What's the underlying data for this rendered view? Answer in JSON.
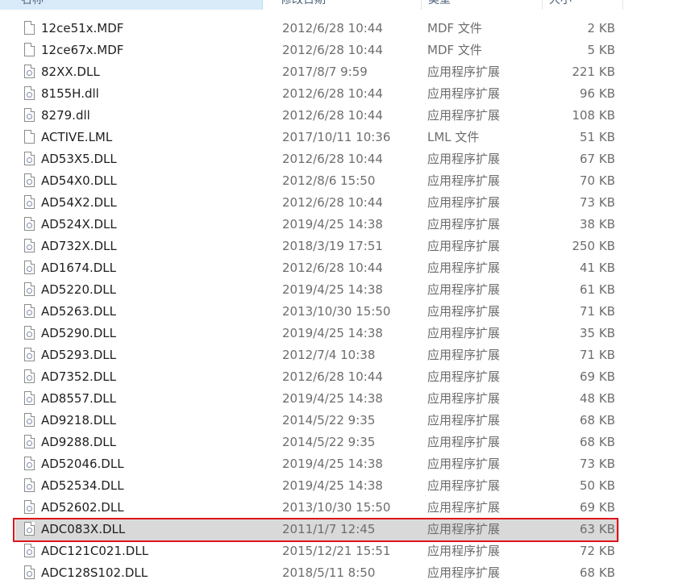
{
  "columns": {
    "name": "名称",
    "date": "修改日期",
    "type": "类型",
    "size": "大小"
  },
  "files": [
    {
      "name": "12ce51x.MDF",
      "date": "2012/6/28 10:44",
      "type": "MDF 文件",
      "size": "2 KB",
      "icon": "generic-file-icon"
    },
    {
      "name": "12ce67x.MDF",
      "date": "2012/6/28 10:44",
      "type": "MDF 文件",
      "size": "5 KB",
      "icon": "generic-file-icon"
    },
    {
      "name": "82XX.DLL",
      "date": "2017/8/7 9:59",
      "type": "应用程序扩展",
      "size": "221 KB",
      "icon": "dll-file-icon"
    },
    {
      "name": "8155H.dll",
      "date": "2012/6/28 10:44",
      "type": "应用程序扩展",
      "size": "96 KB",
      "icon": "dll-file-icon"
    },
    {
      "name": "8279.dll",
      "date": "2012/6/28 10:44",
      "type": "应用程序扩展",
      "size": "108 KB",
      "icon": "dll-file-icon"
    },
    {
      "name": "ACTIVE.LML",
      "date": "2017/10/11 10:36",
      "type": "LML 文件",
      "size": "51 KB",
      "icon": "generic-file-icon"
    },
    {
      "name": "AD53X5.DLL",
      "date": "2012/6/28 10:44",
      "type": "应用程序扩展",
      "size": "67 KB",
      "icon": "dll-file-icon"
    },
    {
      "name": "AD54X0.DLL",
      "date": "2012/8/6 15:50",
      "type": "应用程序扩展",
      "size": "70 KB",
      "icon": "dll-file-icon"
    },
    {
      "name": "AD54X2.DLL",
      "date": "2012/6/28 10:44",
      "type": "应用程序扩展",
      "size": "73 KB",
      "icon": "dll-file-icon"
    },
    {
      "name": "AD524X.DLL",
      "date": "2019/4/25 14:38",
      "type": "应用程序扩展",
      "size": "38 KB",
      "icon": "dll-file-icon"
    },
    {
      "name": "AD732X.DLL",
      "date": "2018/3/19 17:51",
      "type": "应用程序扩展",
      "size": "250 KB",
      "icon": "dll-file-icon"
    },
    {
      "name": "AD1674.DLL",
      "date": "2012/6/28 10:44",
      "type": "应用程序扩展",
      "size": "41 KB",
      "icon": "dll-file-icon"
    },
    {
      "name": "AD5220.DLL",
      "date": "2019/4/25 14:38",
      "type": "应用程序扩展",
      "size": "61 KB",
      "icon": "dll-file-icon"
    },
    {
      "name": "AD5263.DLL",
      "date": "2013/10/30 15:50",
      "type": "应用程序扩展",
      "size": "71 KB",
      "icon": "dll-file-icon"
    },
    {
      "name": "AD5290.DLL",
      "date": "2019/4/25 14:38",
      "type": "应用程序扩展",
      "size": "35 KB",
      "icon": "dll-file-icon"
    },
    {
      "name": "AD5293.DLL",
      "date": "2012/7/4 10:38",
      "type": "应用程序扩展",
      "size": "71 KB",
      "icon": "dll-file-icon"
    },
    {
      "name": "AD7352.DLL",
      "date": "2012/6/28 10:44",
      "type": "应用程序扩展",
      "size": "69 KB",
      "icon": "dll-file-icon"
    },
    {
      "name": "AD8557.DLL",
      "date": "2019/4/25 14:38",
      "type": "应用程序扩展",
      "size": "48 KB",
      "icon": "dll-file-icon"
    },
    {
      "name": "AD9218.DLL",
      "date": "2014/5/22 9:35",
      "type": "应用程序扩展",
      "size": "68 KB",
      "icon": "dll-file-icon"
    },
    {
      "name": "AD9288.DLL",
      "date": "2014/5/22 9:35",
      "type": "应用程序扩展",
      "size": "68 KB",
      "icon": "dll-file-icon"
    },
    {
      "name": "AD52046.DLL",
      "date": "2019/4/25 14:38",
      "type": "应用程序扩展",
      "size": "73 KB",
      "icon": "dll-file-icon"
    },
    {
      "name": "AD52534.DLL",
      "date": "2019/4/25 14:38",
      "type": "应用程序扩展",
      "size": "50 KB",
      "icon": "dll-file-icon"
    },
    {
      "name": "AD52602.DLL",
      "date": "2013/10/30 15:50",
      "type": "应用程序扩展",
      "size": "69 KB",
      "icon": "dll-file-icon"
    },
    {
      "name": "ADC083X.DLL",
      "date": "2011/1/7 12:45",
      "type": "应用程序扩展",
      "size": "63 KB",
      "icon": "dll-file-icon",
      "selected": true
    },
    {
      "name": "ADC121C021.DLL",
      "date": "2015/12/21 15:51",
      "type": "应用程序扩展",
      "size": "72 KB",
      "icon": "dll-file-icon"
    },
    {
      "name": "ADC128S102.DLL",
      "date": "2018/5/11 8:50",
      "type": "应用程序扩展",
      "size": "68 KB",
      "icon": "dll-file-icon"
    }
  ],
  "colors": {
    "selected_row_bg": "#d9d9d9",
    "highlight_outline": "#e0141b"
  }
}
